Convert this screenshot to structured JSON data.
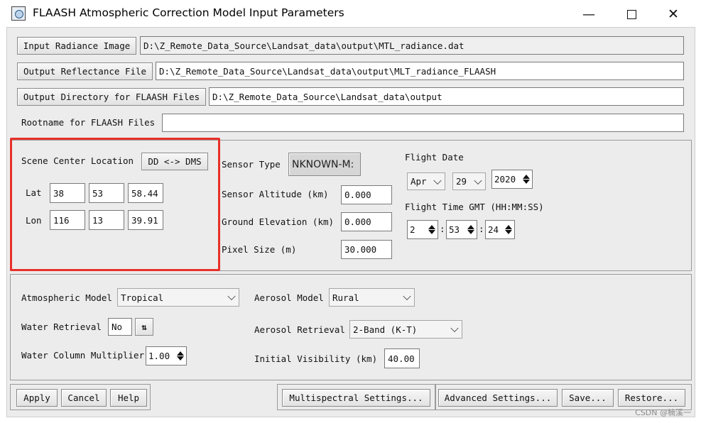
{
  "window": {
    "title": "FLAASH Atmospheric Correction Model Input Parameters",
    "minimize_glyph": "—",
    "close_glyph": "✕"
  },
  "files": {
    "input_radiance_label": "Input Radiance Image",
    "input_radiance_value": "D:\\Z_Remote_Data_Source\\Landsat_data\\output\\MTL_radiance.dat",
    "output_reflectance_label": "Output Reflectance File",
    "output_reflectance_value": "D:\\Z_Remote_Data_Source\\Landsat_data\\output\\MLT_radiance_FLAASH",
    "output_directory_label": "Output Directory for FLAASH Files",
    "output_directory_value": "D:\\Z_Remote_Data_Source\\Landsat_data\\output",
    "rootname_label": "Rootname for FLAASH Files",
    "rootname_value": ""
  },
  "scene": {
    "title": "Scene Center Location",
    "toggle_label": "DD <-> DMS",
    "lat_label": "Lat",
    "lat": [
      "38",
      "53",
      "58.44"
    ],
    "lon_label": "Lon",
    "lon": [
      "116",
      "13",
      "39.91"
    ]
  },
  "sensor": {
    "type_label": "Sensor Type",
    "type_value": "NKNOWN-M:",
    "altitude_label": "Sensor Altitude (km)",
    "altitude_value": "0.000",
    "ground_label": "Ground Elevation (km)",
    "ground_value": "0.000",
    "pixel_label": "Pixel Size (m)",
    "pixel_value": "30.000"
  },
  "flight": {
    "date_label": "Flight Date",
    "month": "Apr",
    "day": "29",
    "year": "2020",
    "time_label": "Flight Time GMT (HH:MM:SS)",
    "hh": "2",
    "mm": "53",
    "ss": "24",
    "sep": ":"
  },
  "atmosphere": {
    "model_label": "Atmospheric Model",
    "model_value": "Tropical",
    "water_label": "Water Retrieval",
    "water_value": "No",
    "water_col_label": "Water Column Multiplier",
    "water_col_value": "1.00",
    "aerosol_model_label": "Aerosol Model",
    "aerosol_model_value": "Rural",
    "aerosol_retrieval_label": "Aerosol Retrieval",
    "aerosol_retrieval_value": "2-Band (K-T)",
    "visibility_label": "Initial Visibility (km)",
    "visibility_value": "40.00"
  },
  "actions": {
    "apply": "Apply",
    "cancel": "Cancel",
    "help": "Help",
    "multispectral": "Multispectral Settings...",
    "advanced": "Advanced Settings...",
    "save": "Save...",
    "restore": "Restore..."
  },
  "watermark": "CSDN @楠溪一",
  "colors": {
    "highlight": "#e8302a",
    "panel_bg": "#ececec"
  }
}
